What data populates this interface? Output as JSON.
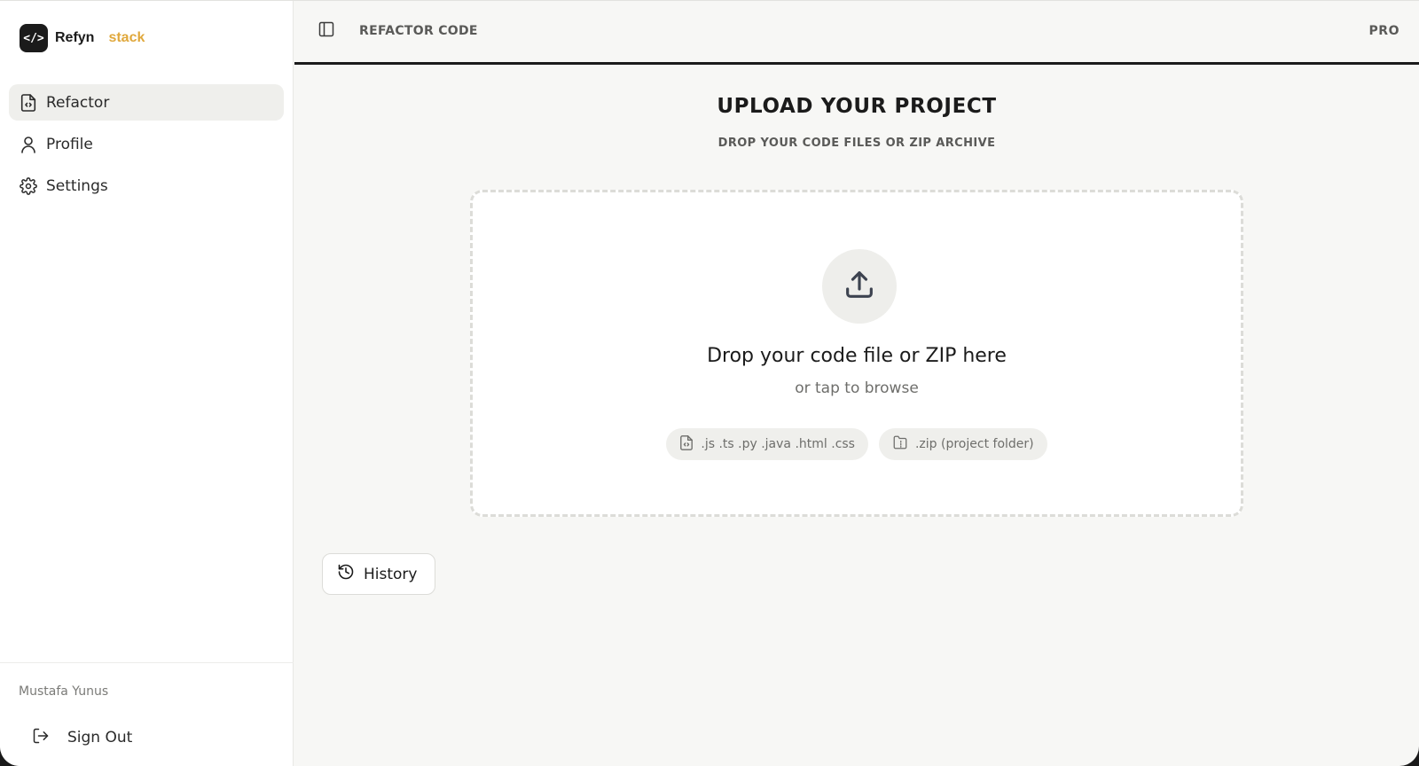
{
  "brand": {
    "logo_glyph": "</>",
    "name": "Refyn",
    "accent": "stack",
    "accent_color": "#e0a83c"
  },
  "sidebar": {
    "items": [
      {
        "label": "Refactor",
        "icon": "file-code-icon",
        "active": true
      },
      {
        "label": "Profile",
        "icon": "user-icon",
        "active": false
      },
      {
        "label": "Settings",
        "icon": "gear-icon",
        "active": false
      }
    ],
    "user_name": "Mustafa Yunus",
    "signout_label": "Sign Out"
  },
  "topbar": {
    "title": "REFACTOR CODE",
    "plan": "PRO"
  },
  "main": {
    "heading": "UPLOAD YOUR PROJECT",
    "subheading": "DROP YOUR CODE FILES OR ZIP ARCHIVE",
    "dropzone": {
      "title": "Drop your code file or ZIP here",
      "subtitle": "or tap to browse",
      "chips": [
        {
          "label": ".js .ts .py .java .html .css",
          "icon": "file-code-icon"
        },
        {
          "label": ".zip (project folder)",
          "icon": "folder-zip-icon"
        }
      ]
    },
    "history_label": "History"
  }
}
